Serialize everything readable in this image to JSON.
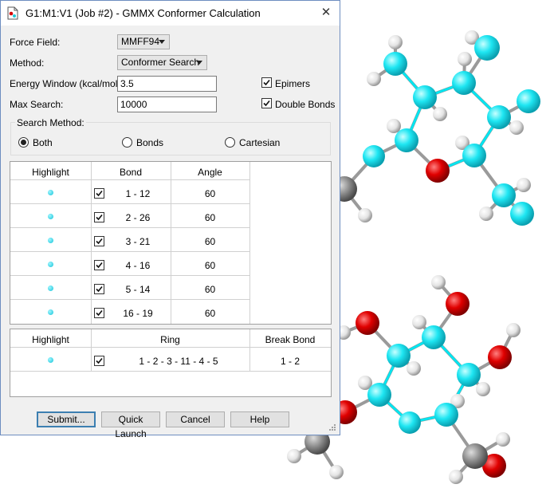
{
  "window": {
    "title": "G1:M1:V1 (Job #2) - GMMX Conformer Calculation",
    "close_glyph": "✕"
  },
  "form": {
    "force_field": {
      "label": "Force Field:",
      "value": "MMFF94"
    },
    "method": {
      "label": "Method:",
      "value": "Conformer Search"
    },
    "energy_window": {
      "label": "Energy Window (kcal/mol):",
      "value": "3.5"
    },
    "max_search": {
      "label": "Max Search:",
      "value": "10000"
    },
    "epimers": {
      "label": "Epimers",
      "checked": true
    },
    "double_bonds": {
      "label": "Double Bonds",
      "checked": true
    }
  },
  "search_method": {
    "label": "Search Method:",
    "options": [
      {
        "label": "Both",
        "selected": true
      },
      {
        "label": "Bonds",
        "selected": false
      },
      {
        "label": "Cartesian",
        "selected": false
      }
    ]
  },
  "bond_table": {
    "headers": [
      "Highlight",
      "Bond",
      "Angle"
    ],
    "rows": [
      {
        "bond": "1 - 12",
        "angle": "60",
        "checked": true
      },
      {
        "bond": "2 - 26",
        "angle": "60",
        "checked": true
      },
      {
        "bond": "3 - 21",
        "angle": "60",
        "checked": true
      },
      {
        "bond": "4 - 16",
        "angle": "60",
        "checked": true
      },
      {
        "bond": "5 - 14",
        "angle": "60",
        "checked": true
      },
      {
        "bond": "16 - 19",
        "angle": "60",
        "checked": true
      }
    ]
  },
  "ring_table": {
    "headers": [
      "Highlight",
      "Ring",
      "Break Bond"
    ],
    "rows": [
      {
        "ring": "1 - 2 - 3 - 11 - 4 - 5",
        "break_bond": "1 - 2",
        "checked": true
      }
    ]
  },
  "buttons": {
    "submit": "Submit...",
    "quick_launch": "Quick Launch",
    "cancel": "Cancel",
    "help": "Help"
  },
  "colors": {
    "carbon": "#00e5f0",
    "oxygen": "#d40000",
    "hydrogen": "#ffffff",
    "methyl_carbon": "#808080",
    "highlight_dot": "#13c3d8",
    "window_border": "#6d8dc0"
  }
}
